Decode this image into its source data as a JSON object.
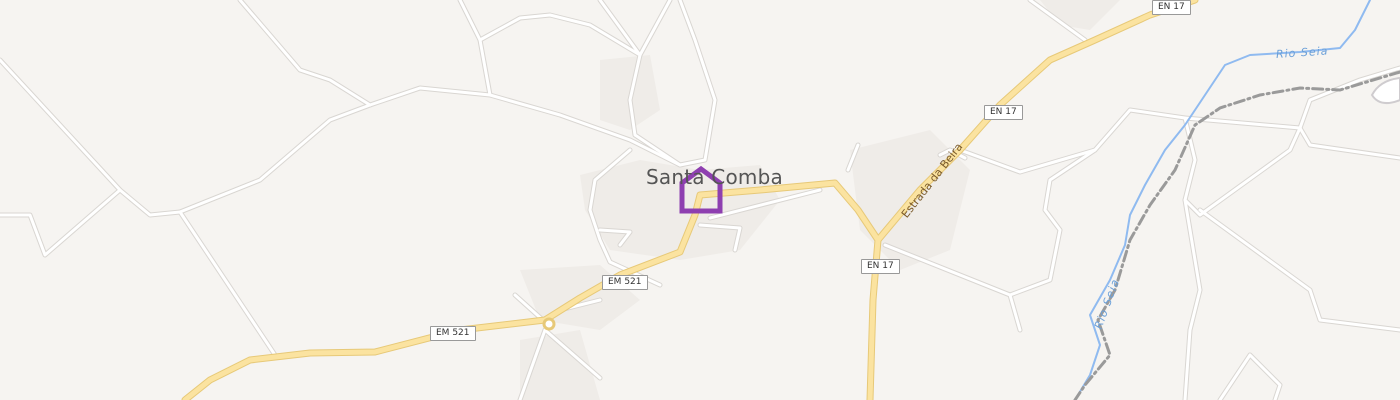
{
  "map": {
    "place_name": "Santa Comba",
    "road_shields": {
      "en17_a": "EN 17",
      "en17_b": "EN 17",
      "en17_c": "EN 17",
      "em521_a": "EM 521",
      "em521_b": "EM 521"
    },
    "road_name": "Estrada da Beira",
    "river_name_a": "Rio Seia",
    "river_name_b": "Rio Seia",
    "marker_icon": "home-marker-icon",
    "colors": {
      "background": "#f6f4f1",
      "major_road": "#fbe3a0",
      "minor_road": "#ffffff",
      "river": "#8fbaf0",
      "railway": "#9a9a9a",
      "marker": "#8e3fb0"
    }
  }
}
